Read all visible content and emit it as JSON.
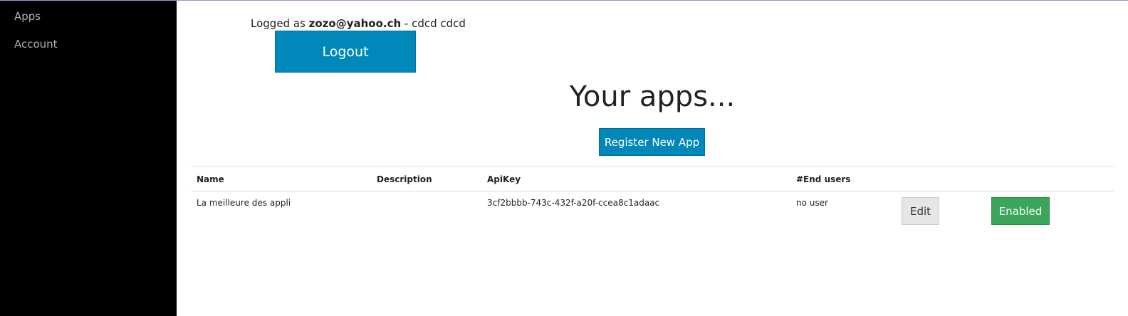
{
  "sidebar": {
    "items": [
      {
        "label": "Apps"
      },
      {
        "label": "Account"
      }
    ]
  },
  "header": {
    "logged_prefix": "Logged as ",
    "email": "zozo@yahoo.ch",
    "user_suffix": " - cdcd cdcd",
    "logout_label": "Logout"
  },
  "main": {
    "title": "Your apps...",
    "register_label": "Register New App"
  },
  "table": {
    "columns": [
      "Name",
      "Description",
      "ApiKey",
      "#End users"
    ],
    "rows": [
      {
        "name": "La meilleure des appli",
        "description": "",
        "apikey": "3cf2bbbb-743c-432f-a20f-ccea8c1adaac",
        "end_users": "no user",
        "edit_label": "Edit",
        "status_label": "Enabled"
      }
    ]
  },
  "colors": {
    "sidebar_bg": "#000000",
    "primary_button": "#0088bb",
    "enabled_button": "#3ba55c",
    "edit_button": "#e6e6e6"
  }
}
